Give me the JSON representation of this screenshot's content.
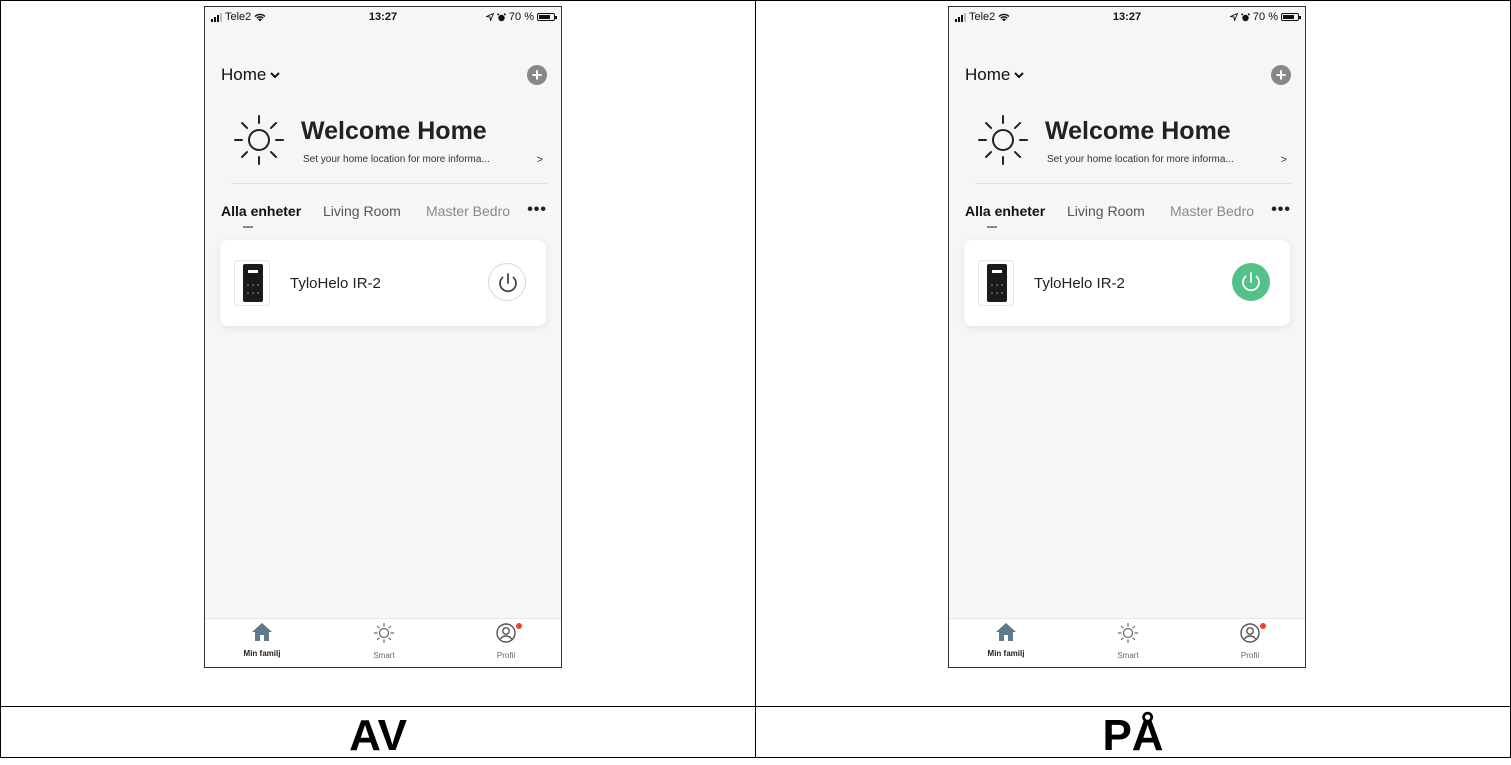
{
  "screens": [
    {
      "status": {
        "carrier": "Tele2",
        "time": "13:27",
        "battery": "70 %"
      },
      "home_label": "Home",
      "welcome_title": "Welcome Home",
      "welcome_sub": "Set your home location for more informa...",
      "welcome_arrow": ">",
      "tabs": [
        "Alla enheter",
        "Living Room",
        "Master Bedro"
      ],
      "more_label": "•••",
      "device_name": "TyloHelo IR-2",
      "power_state": "off",
      "nav": [
        "Min familj",
        "Smart",
        "Profil"
      ],
      "caption": "AV"
    },
    {
      "status": {
        "carrier": "Tele2",
        "time": "13:27",
        "battery": "70 %"
      },
      "home_label": "Home",
      "welcome_title": "Welcome Home",
      "welcome_sub": "Set your home location for more informa...",
      "welcome_arrow": ">",
      "tabs": [
        "Alla enheter",
        "Living Room",
        "Master Bedro"
      ],
      "more_label": "•••",
      "device_name": "TyloHelo IR-2",
      "power_state": "on",
      "nav": [
        "Min familj",
        "Smart",
        "Profil"
      ],
      "caption": "PÅ"
    }
  ],
  "colors": {
    "power_on": "#54c18a",
    "badge": "#f0432f"
  },
  "icons": [
    "signal-icon",
    "wifi-icon",
    "location-icon",
    "alarm-icon",
    "battery-icon",
    "chevron-down-icon",
    "add-icon",
    "sun-icon",
    "power-icon",
    "home-icon",
    "smart-icon",
    "profile-icon"
  ]
}
